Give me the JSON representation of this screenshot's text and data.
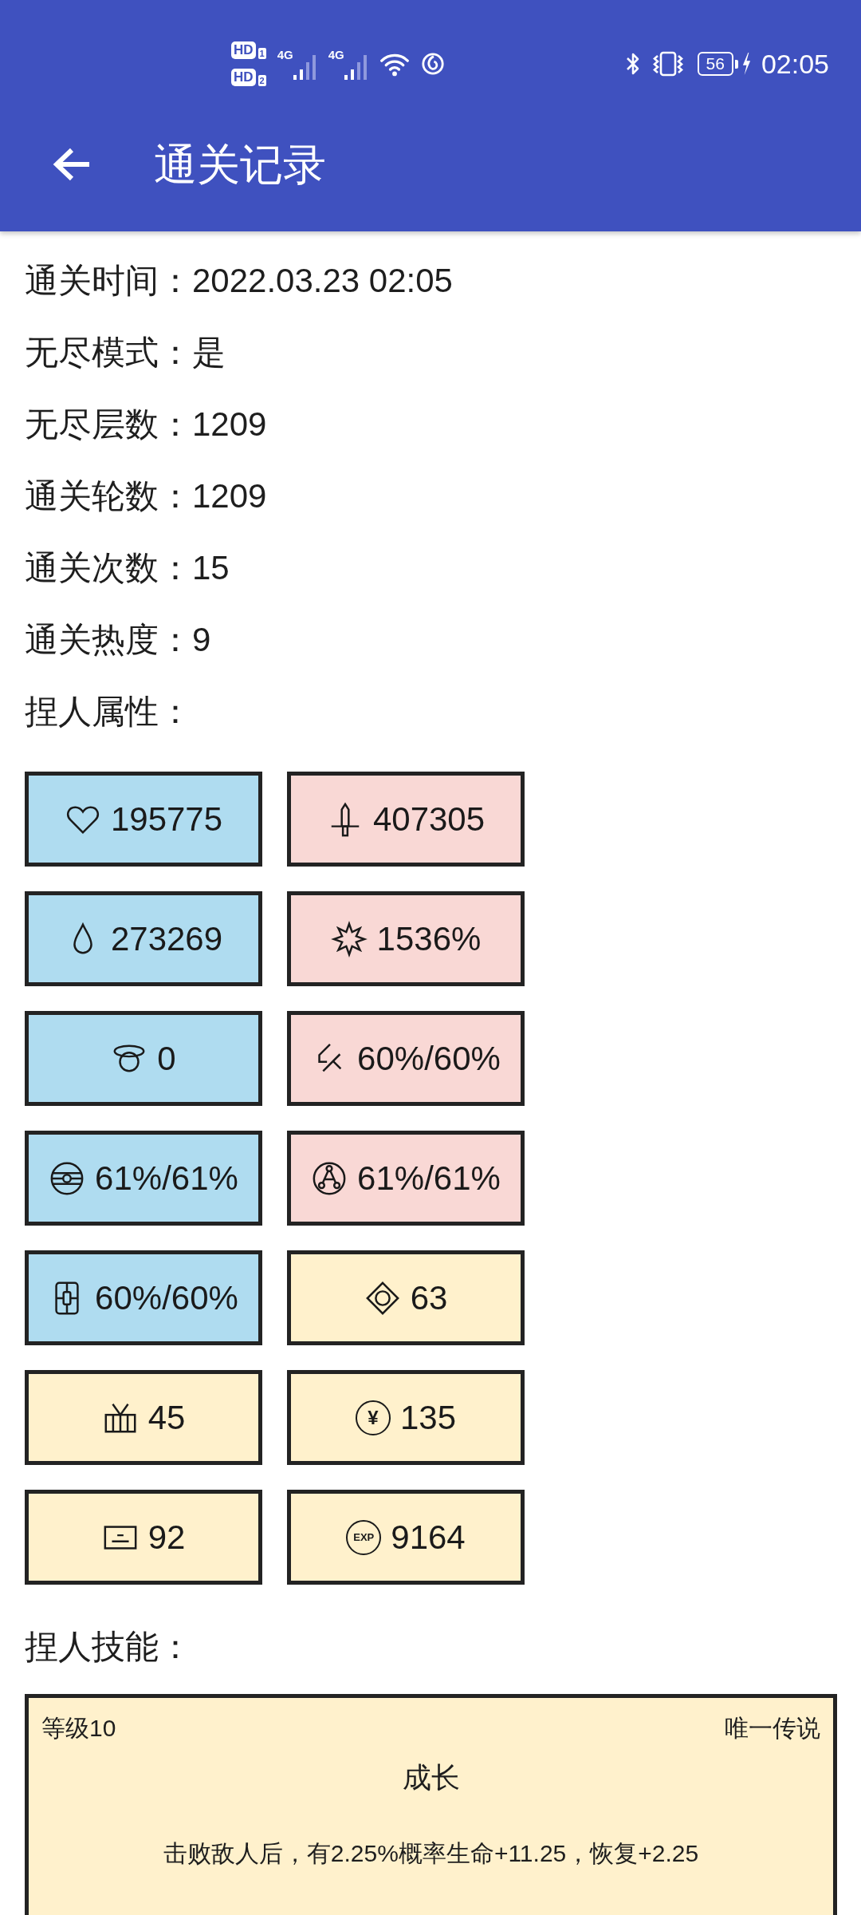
{
  "status_bar": {
    "sims": [
      {
        "badge": "HD",
        "slot": "1"
      },
      {
        "badge": "HD",
        "slot": "2"
      }
    ],
    "signals": [
      {
        "network": "4G"
      },
      {
        "network": "4G"
      }
    ],
    "battery": "56",
    "charging": true,
    "time": "02:05"
  },
  "app_bar": {
    "title": "通关记录"
  },
  "record": [
    {
      "label": "通关时间：",
      "value": "2022.03.23 02:05"
    },
    {
      "label": "无尽模式：",
      "value": "是"
    },
    {
      "label": "无尽层数：",
      "value": "1209"
    },
    {
      "label": "通关轮数：",
      "value": "1209"
    },
    {
      "label": "通关次数：",
      "value": "15"
    },
    {
      "label": "通关热度：",
      "value": "9"
    }
  ],
  "attributes": {
    "heading": "捏人属性：",
    "items": [
      {
        "kind": "heart",
        "value": "195775",
        "color": "#afdcf0"
      },
      {
        "kind": "sword",
        "value": "407305",
        "color": "#f9d8d5"
      },
      {
        "kind": "drop",
        "value": "273269",
        "color": "#afdcf0"
      },
      {
        "kind": "star",
        "value": "1536%",
        "color": "#f9d8d5"
      },
      {
        "kind": "halo",
        "value": "0",
        "color": "#afdcf0"
      },
      {
        "kind": "blade",
        "value": "60%/60%",
        "color": "#f9d8d5"
      },
      {
        "kind": "globe",
        "value": "61%/61%",
        "color": "#afdcf0"
      },
      {
        "kind": "triad",
        "value": "61%/61%",
        "color": "#f9d8d5"
      },
      {
        "kind": "tablet",
        "value": "60%/60%",
        "color": "#afdcf0"
      },
      {
        "kind": "diamond",
        "value": "63",
        "color": "#fff1cc"
      },
      {
        "kind": "crate",
        "value": "45",
        "color": "#fff1cc"
      },
      {
        "kind": "coin",
        "symbol": "¥",
        "value": "135",
        "color": "#fff1cc"
      },
      {
        "kind": "panel",
        "value": "92",
        "color": "#fff1cc"
      },
      {
        "kind": "badge",
        "symbol": "EXP",
        "value": "9164",
        "color": "#fff1cc"
      }
    ]
  },
  "skills": {
    "heading": "捏人技能：",
    "items": [
      {
        "level": "等级10",
        "rarity": "唯一传说",
        "name": "成长",
        "description": "击败敌人后，有2.25%概率生命+11.25，恢复+2.25"
      }
    ]
  }
}
